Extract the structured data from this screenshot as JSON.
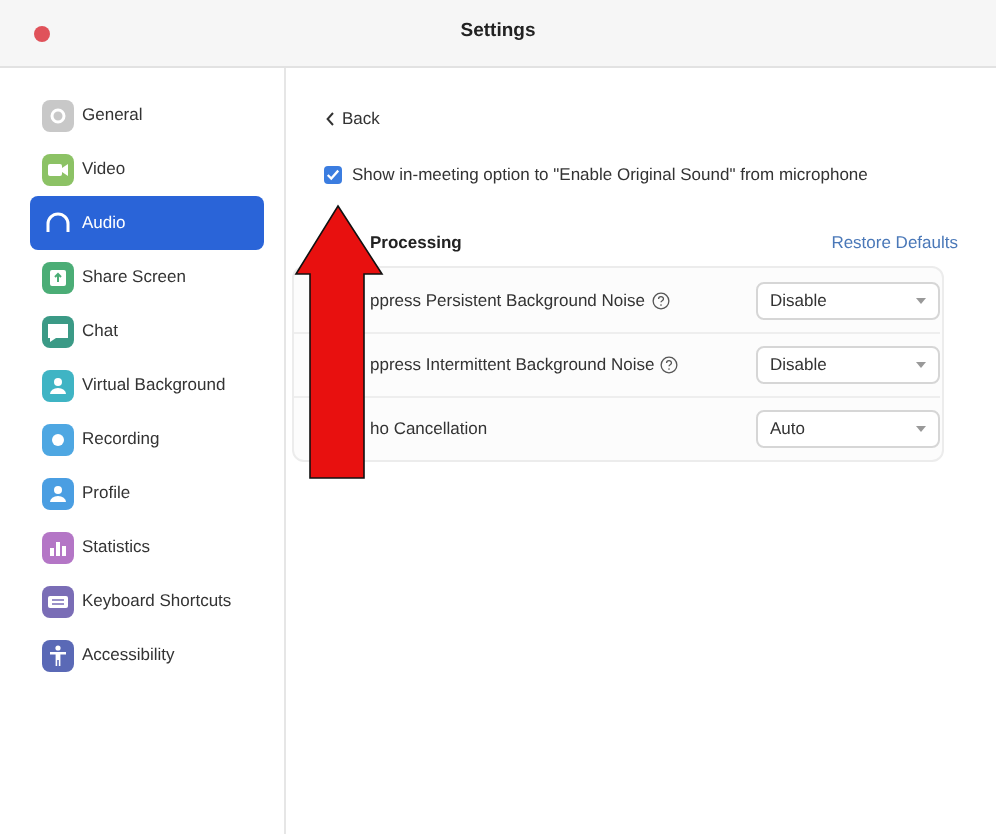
{
  "window": {
    "title": "Settings"
  },
  "sidebar": {
    "items": [
      {
        "label": "General",
        "kind": "gear",
        "color": "#c8c8c8",
        "selected": false
      },
      {
        "label": "Video",
        "kind": "camera",
        "color": "#8cc265",
        "selected": false
      },
      {
        "label": "Audio",
        "kind": "headphones",
        "selected": true
      },
      {
        "label": "Share Screen",
        "kind": "share",
        "color": "#4bad76",
        "selected": false
      },
      {
        "label": "Chat",
        "kind": "chat",
        "color": "#3b9a86",
        "selected": false
      },
      {
        "label": "Virtual Background",
        "kind": "person",
        "color": "#3fb4c4",
        "selected": false
      },
      {
        "label": "Recording",
        "kind": "record",
        "color": "#4ea7e2",
        "selected": false
      },
      {
        "label": "Profile",
        "kind": "person",
        "color": "#4a9ee2",
        "selected": false
      },
      {
        "label": "Statistics",
        "kind": "bars",
        "color": "#b476c6",
        "selected": false
      },
      {
        "label": "Keyboard Shortcuts",
        "kind": "keyboard",
        "color": "#7a6db6",
        "selected": false
      },
      {
        "label": "Accessibility",
        "kind": "accessibility",
        "color": "#5a69b6",
        "selected": false
      }
    ]
  },
  "back": "Back",
  "original_sound": {
    "label": "Show in-meeting option to \"Enable Original Sound\" from microphone",
    "checked": true
  },
  "section": {
    "title": "Processing",
    "restore": "Restore Defaults"
  },
  "rows": [
    {
      "label": "ppress Persistent Background Noise",
      "help": true,
      "value": "Disable"
    },
    {
      "label": "ppress Intermittent Background Noise",
      "help": true,
      "value": "Disable"
    },
    {
      "label": "ho Cancellation",
      "help": false,
      "value": "Auto"
    }
  ]
}
